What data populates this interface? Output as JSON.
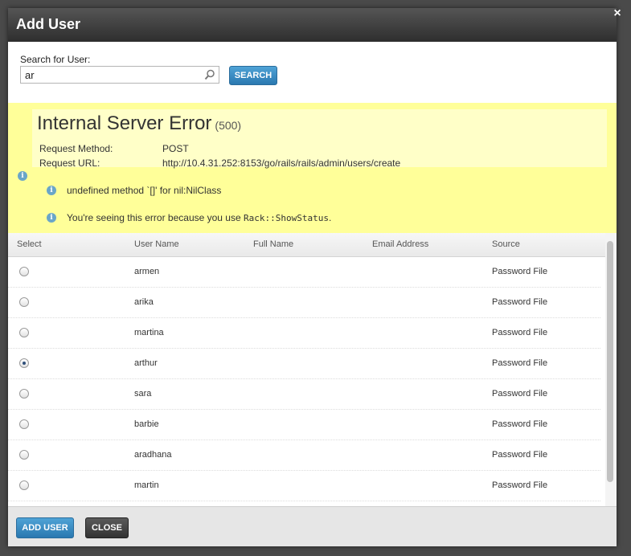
{
  "dialog": {
    "title": "Add User",
    "close_glyph": "×"
  },
  "search": {
    "label": "Search for User:",
    "value": "ar",
    "button_label": "SEARCH"
  },
  "error": {
    "title": "Internal Server Error",
    "code": "(500)",
    "method_label": "Request Method:",
    "method_value": "POST",
    "url_label": "Request URL:",
    "url_value": "http://10.4.31.252:8153/go/rails/rails/admin/users/create",
    "message": "undefined method `[]' for nil:NilClass",
    "status_prefix": "You're seeing this error because you use ",
    "status_code": "Rack::ShowStatus",
    "status_suffix": "."
  },
  "table": {
    "headers": [
      "Select",
      "User Name",
      "Full Name",
      "Email Address",
      "Source"
    ],
    "rows": [
      {
        "username": "armen",
        "fullname": "",
        "email": "",
        "source": "Password File",
        "selected": false
      },
      {
        "username": "arika",
        "fullname": "",
        "email": "",
        "source": "Password File",
        "selected": false
      },
      {
        "username": "martina",
        "fullname": "",
        "email": "",
        "source": "Password File",
        "selected": false
      },
      {
        "username": "arthur",
        "fullname": "",
        "email": "",
        "source": "Password File",
        "selected": true
      },
      {
        "username": "sara",
        "fullname": "",
        "email": "",
        "source": "Password File",
        "selected": false
      },
      {
        "username": "barbie",
        "fullname": "",
        "email": "",
        "source": "Password File",
        "selected": false
      },
      {
        "username": "aradhana",
        "fullname": "",
        "email": "",
        "source": "Password File",
        "selected": false
      },
      {
        "username": "martin",
        "fullname": "",
        "email": "",
        "source": "Password File",
        "selected": false
      }
    ]
  },
  "footer": {
    "add_label": "ADD USER",
    "close_label": "CLOSE"
  },
  "colors": {
    "accent_blue": "#2a78b0",
    "error_background": "#ffff99",
    "title_bar": "#2e2e2e"
  }
}
